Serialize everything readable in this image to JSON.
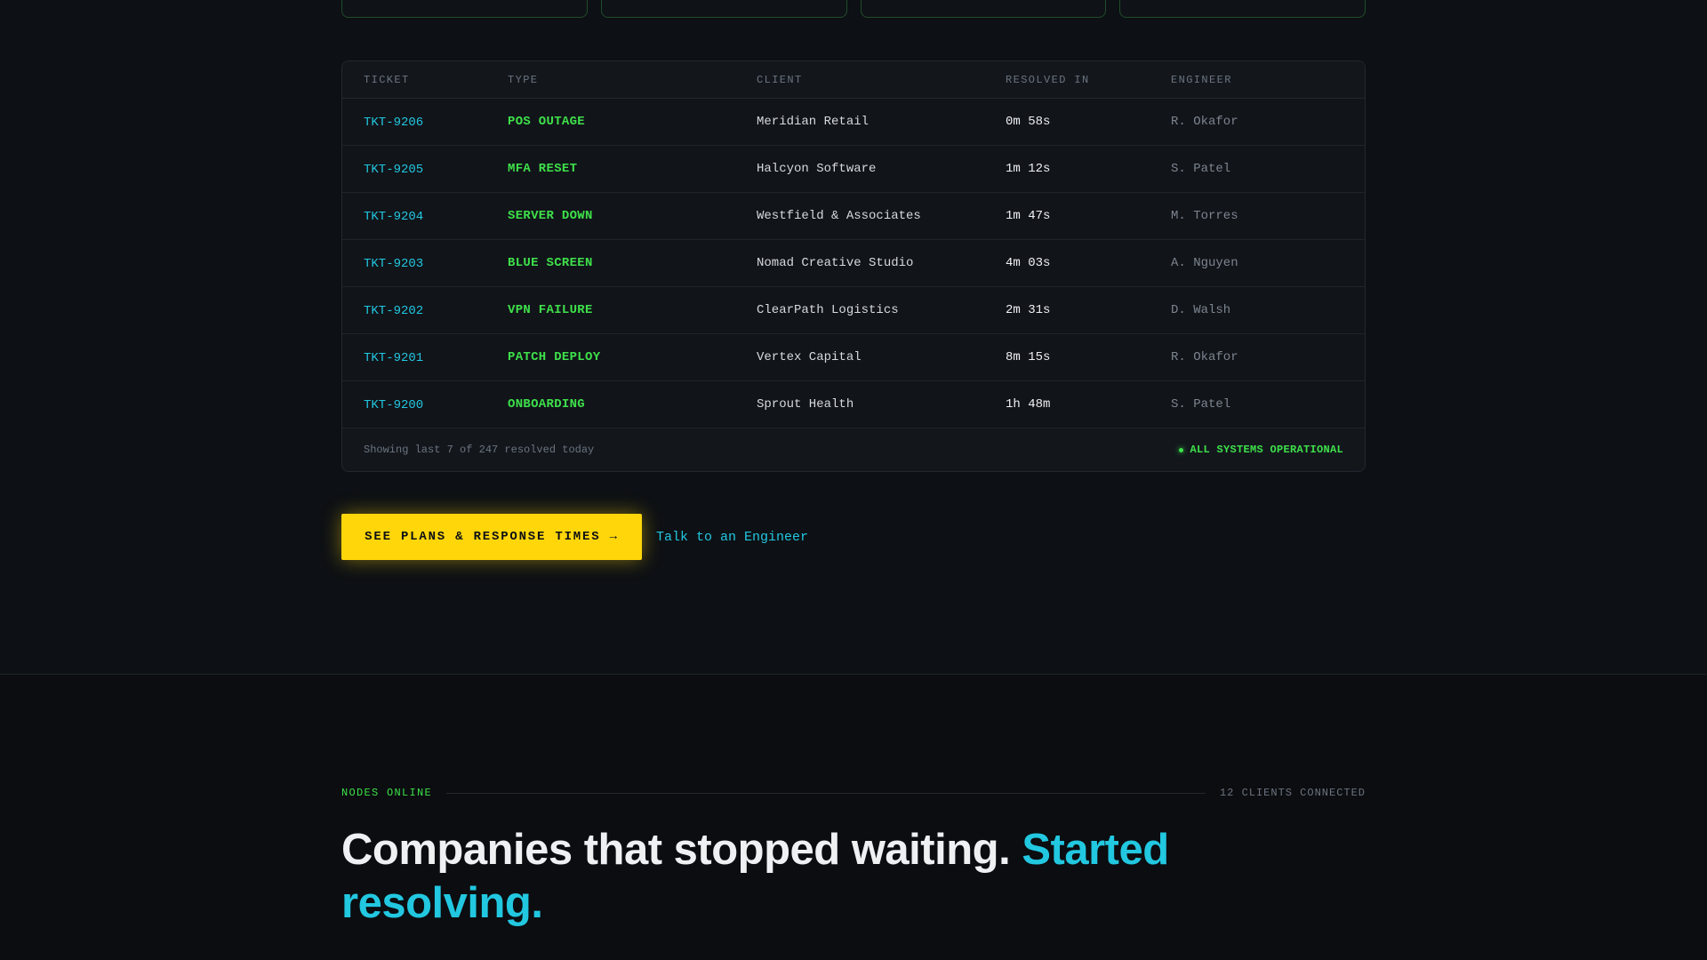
{
  "table": {
    "headers": [
      "TICKET",
      "TYPE",
      "CLIENT",
      "RESOLVED IN",
      "ENGINEER"
    ],
    "rows": [
      {
        "ticket": "TKT-9206",
        "type": "POS OUTAGE",
        "client": "Meridian Retail",
        "resolved": "0m 58s",
        "engineer": "R. Okafor"
      },
      {
        "ticket": "TKT-9205",
        "type": "MFA RESET",
        "client": "Halcyon Software",
        "resolved": "1m 12s",
        "engineer": "S. Patel"
      },
      {
        "ticket": "TKT-9204",
        "type": "SERVER DOWN",
        "client": "Westfield & Associates",
        "resolved": "1m 47s",
        "engineer": "M. Torres"
      },
      {
        "ticket": "TKT-9203",
        "type": "BLUE SCREEN",
        "client": "Nomad Creative Studio",
        "resolved": "4m 03s",
        "engineer": "A. Nguyen"
      },
      {
        "ticket": "TKT-9202",
        "type": "VPN FAILURE",
        "client": "ClearPath Logistics",
        "resolved": "2m 31s",
        "engineer": "D. Walsh"
      },
      {
        "ticket": "TKT-9201",
        "type": "PATCH DEPLOY",
        "client": "Vertex Capital",
        "resolved": "8m 15s",
        "engineer": "R. Okafor"
      },
      {
        "ticket": "TKT-9200",
        "type": "ONBOARDING",
        "client": "Sprout Health",
        "resolved": "1h 48m",
        "engineer": "S. Patel"
      }
    ],
    "footer_note": "Showing last 7 of 247 resolved today",
    "status": "ALL SYSTEMS OPERATIONAL"
  },
  "cta": {
    "primary": "SEE PLANS & RESPONSE TIMES →",
    "secondary": "Talk to an Engineer"
  },
  "nodes": {
    "label": "NODES ONLINE",
    "count": "12 CLIENTS CONNECTED"
  },
  "headline": {
    "main": "Companies that stopped waiting. ",
    "accent": "Started resolving."
  },
  "colors": {
    "accent_cyan": "#22c7e0",
    "accent_green": "#3ee04a",
    "cta_yellow": "#ffd60a",
    "background": "#0d1014"
  }
}
